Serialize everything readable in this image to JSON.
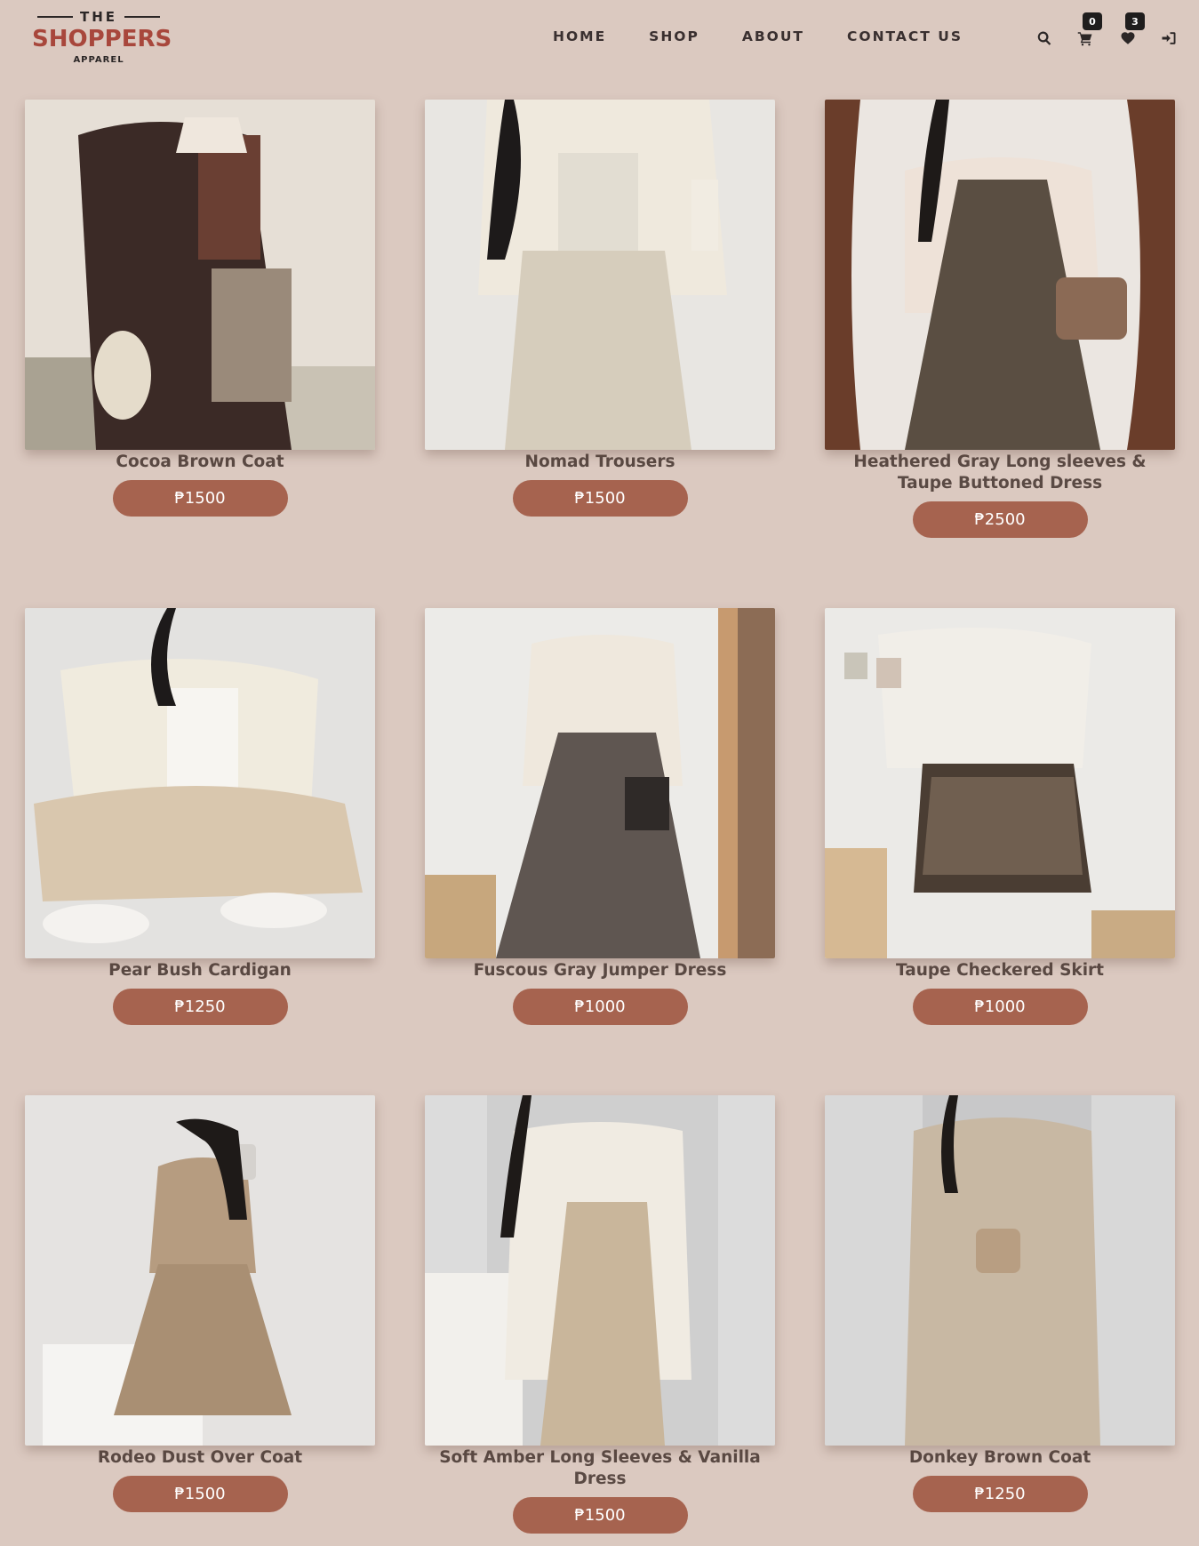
{
  "brand": {
    "top": "THE",
    "name": "SHOPPERS",
    "sub": "APPAREL"
  },
  "nav": [
    "HOME",
    "SHOP",
    "ABOUT",
    "CONTACT US"
  ],
  "header_icons": {
    "search": "search-icon",
    "cart": "cart-icon",
    "wishlist": "heart-icon",
    "login": "sign-in-icon",
    "cart_count": "0",
    "wishlist_count": "3"
  },
  "colors": {
    "background": "#dbc9c0",
    "accent": "#a6634f",
    "brand": "#a8473c"
  },
  "products": [
    {
      "name": "Cocoa Brown Coat",
      "price": "₱1500"
    },
    {
      "name": "Nomad Trousers",
      "price": "₱1500"
    },
    {
      "name": "Heathered Gray Long sleeves & Taupe Buttoned Dress",
      "price": "₱2500"
    },
    {
      "name": "Pear Bush Cardigan",
      "price": "₱1250"
    },
    {
      "name": "Fuscous Gray Jumper Dress",
      "price": "₱1000"
    },
    {
      "name": "Taupe Checkered Skirt",
      "price": "₱1000"
    },
    {
      "name": "Rodeo Dust Over Coat",
      "price": "₱1500"
    },
    {
      "name": "Soft Amber Long Sleeves & Vanilla Dress",
      "price": "₱1500"
    },
    {
      "name": "Donkey Brown Coat",
      "price": "₱1250"
    }
  ]
}
